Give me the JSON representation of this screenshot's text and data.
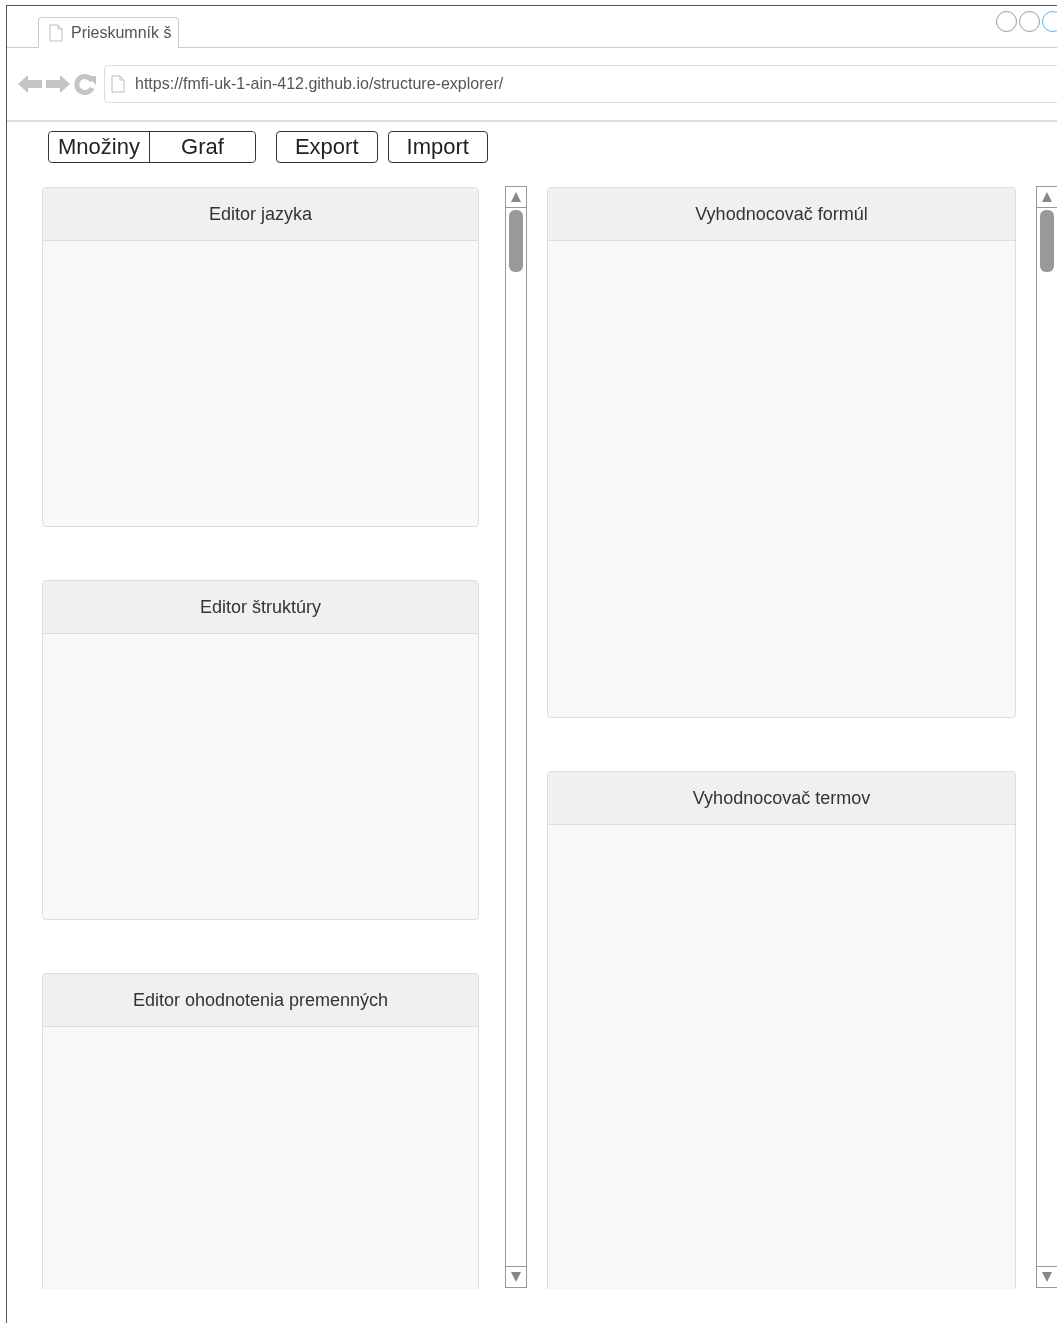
{
  "browser": {
    "tab_title": "Prieskumník š",
    "url": "https://fmfi-uk-1-ain-412.github.io/structure-explorer/"
  },
  "toolbar": {
    "view_buttons": [
      "Množiny",
      "Graf"
    ],
    "actions": [
      "Export",
      "Import"
    ]
  },
  "left_panels": [
    {
      "title": "Editor jazyka"
    },
    {
      "title": "Editor štruktúry"
    },
    {
      "title": "Editor ohodnotenia premenných"
    }
  ],
  "right_panels": [
    {
      "title": "Vyhodnocovač formúl"
    },
    {
      "title": "Vyhodnocovač termov"
    }
  ]
}
